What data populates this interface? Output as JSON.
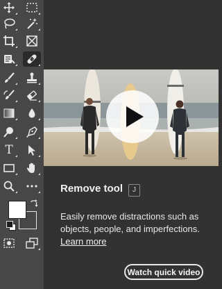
{
  "toolbar": {
    "tools": [
      {
        "name": "move-tool",
        "icon": "move-icon"
      },
      {
        "name": "marquee-tool",
        "icon": "rect-marquee-icon"
      },
      {
        "name": "lasso-tool",
        "icon": "lasso-icon"
      },
      {
        "name": "magic-wand-tool",
        "icon": "magic-wand-icon"
      },
      {
        "name": "crop-tool",
        "icon": "crop-icon"
      },
      {
        "name": "frame-tool",
        "icon": "frame-icon"
      },
      {
        "name": "eyedropper-tool",
        "icon": "eyedropper-icon"
      },
      {
        "name": "remove-tool",
        "icon": "bandage-icon",
        "active": true
      },
      {
        "name": "brush-tool",
        "icon": "brush-icon"
      },
      {
        "name": "stamp-tool",
        "icon": "stamp-icon"
      },
      {
        "name": "history-brush-tool",
        "icon": "history-brush-icon"
      },
      {
        "name": "eraser-tool",
        "icon": "eraser-icon"
      },
      {
        "name": "gradient-tool",
        "icon": "gradient-icon"
      },
      {
        "name": "blur-tool",
        "icon": "drop-icon"
      },
      {
        "name": "dodge-tool",
        "icon": "dodge-icon"
      },
      {
        "name": "pen-tool",
        "icon": "pen-icon"
      },
      {
        "name": "type-tool",
        "icon": "type-icon",
        "glyph": "T"
      },
      {
        "name": "path-select-tool",
        "icon": "arrow-icon"
      },
      {
        "name": "shape-tool",
        "icon": "rectangle-icon"
      },
      {
        "name": "hand-tool",
        "icon": "hand-icon"
      },
      {
        "name": "zoom-tool",
        "icon": "zoom-icon"
      },
      {
        "name": "more-tools",
        "icon": "ellipsis-icon"
      }
    ],
    "foreground_color": "#ffffff",
    "background_color": "#474747"
  },
  "tooltip": {
    "title": "Remove tool",
    "shortcut": "J",
    "description": "Easily remove distractions such as objects, people, and imperfections.",
    "learn_more": "Learn more",
    "button": "Watch quick video"
  },
  "colors": {
    "toolbar_bg": "#474747",
    "panel_bg": "#323232",
    "text": "#f0f0f0"
  }
}
